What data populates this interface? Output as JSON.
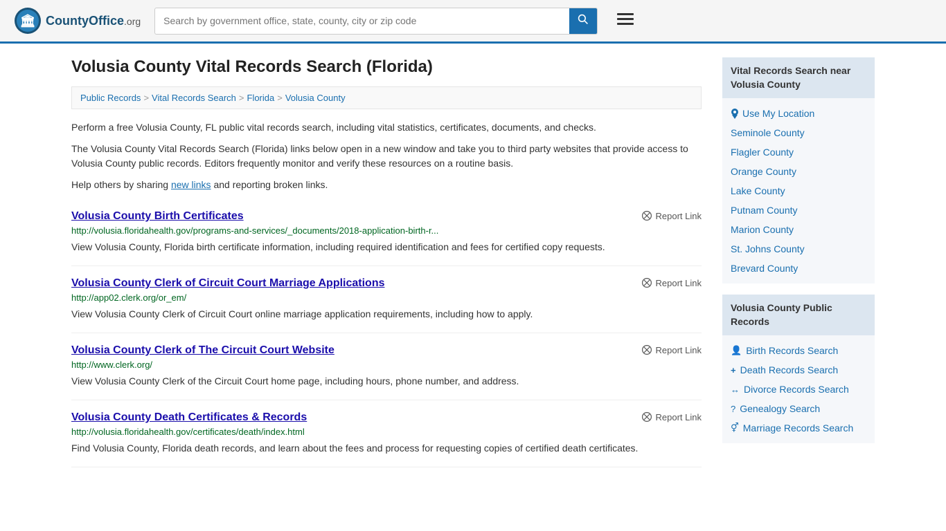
{
  "header": {
    "logo_text": "CountyOffice",
    "logo_org": ".org",
    "search_placeholder": "Search by government office, state, county, city or zip code",
    "search_button_label": "🔍",
    "menu_button_label": "≡"
  },
  "page": {
    "title": "Volusia County Vital Records Search (Florida)"
  },
  "breadcrumb": {
    "items": [
      {
        "label": "Public Records",
        "href": "#"
      },
      {
        "label": "Vital Records Search",
        "href": "#"
      },
      {
        "label": "Florida",
        "href": "#"
      },
      {
        "label": "Volusia County",
        "href": "#"
      }
    ]
  },
  "description": {
    "para1": "Perform a free Volusia County, FL public vital records search, including vital statistics, certificates, documents, and checks.",
    "para2": "The Volusia County Vital Records Search (Florida) links below open in a new window and take you to third party websites that provide access to Volusia County public records. Editors frequently monitor and verify these resources on a routine basis.",
    "para3_prefix": "Help others by sharing ",
    "para3_link": "new links",
    "para3_suffix": " and reporting broken links."
  },
  "results": [
    {
      "title": "Volusia County Birth Certificates",
      "url": "http://volusia.floridahealth.gov/programs-and-services/_documents/2018-application-birth-r...",
      "desc": "View Volusia County, Florida birth certificate information, including required identification and fees for certified copy requests.",
      "report_label": "Report Link"
    },
    {
      "title": "Volusia County Clerk of Circuit Court Marriage Applications",
      "url": "http://app02.clerk.org/or_em/",
      "desc": "View Volusia County Clerk of Circuit Court online marriage application requirements, including how to apply.",
      "report_label": "Report Link"
    },
    {
      "title": "Volusia County Clerk of The Circuit Court Website",
      "url": "http://www.clerk.org/",
      "desc": "View Volusia County Clerk of the Circuit Court home page, including hours, phone number, and address.",
      "report_label": "Report Link"
    },
    {
      "title": "Volusia County Death Certificates & Records",
      "url": "http://volusia.floridahealth.gov/certificates/death/index.html",
      "desc": "Find Volusia County, Florida death records, and learn about the fees and process for requesting copies of certified death certificates.",
      "report_label": "Report Link"
    }
  ],
  "sidebar": {
    "nearby_header": "Vital Records Search near Volusia County",
    "use_location_label": "Use My Location",
    "nearby_counties": [
      {
        "label": "Seminole County"
      },
      {
        "label": "Flagler County"
      },
      {
        "label": "Orange County"
      },
      {
        "label": "Lake County"
      },
      {
        "label": "Putnam County"
      },
      {
        "label": "Marion County"
      },
      {
        "label": "St. Johns County"
      },
      {
        "label": "Brevard County"
      }
    ],
    "public_records_header": "Volusia County Public Records",
    "public_records_links": [
      {
        "icon": "👤",
        "label": "Birth Records Search"
      },
      {
        "icon": "+",
        "label": "Death Records Search"
      },
      {
        "icon": "↔",
        "label": "Divorce Records Search"
      },
      {
        "icon": "?",
        "label": "Genealogy Search"
      },
      {
        "icon": "♂",
        "label": "Marriage Records Search"
      }
    ]
  }
}
